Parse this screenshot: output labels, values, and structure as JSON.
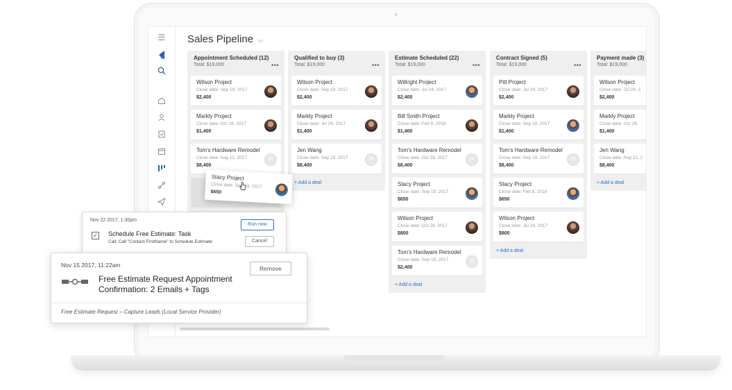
{
  "app": {
    "title": "Sales Pipeline"
  },
  "sidebar": {
    "icons": [
      "menu-icon",
      "logo-icon",
      "search-icon",
      "home-icon",
      "contacts-icon",
      "tasks-icon",
      "calendar-icon",
      "pipeline-icon",
      "automation-icon",
      "send-icon"
    ]
  },
  "columns": [
    {
      "name": "Appointment Scheduled (12)",
      "total": "Total: $19,000",
      "more": "•••",
      "cards": [
        {
          "name": "Wilson Project",
          "date": "Close date: Sep 19, 2017",
          "amount": "$2,400",
          "avatar": "photo"
        },
        {
          "name": "Markly Project",
          "date": "Close date: Oct 28, 2017",
          "amount": "$1,400",
          "avatar": "photo"
        },
        {
          "name": "Tom's Hardware Remodel",
          "date": "Close date: Aug 12, 2017",
          "amount": "$8,400",
          "avatar": "JR"
        }
      ]
    },
    {
      "name": "Qualified to buy (3)",
      "total": "Total: $19,000",
      "more": "•••",
      "cards": [
        {
          "name": "Wilson Project",
          "date": "Close date: Sep 19, 2017",
          "amount": "$2,400",
          "avatar": "photo"
        },
        {
          "name": "Markly Project",
          "date": "Close date: Jul 24, 2017",
          "amount": "$1,400",
          "avatar": "photo"
        },
        {
          "name": "Jen Wang",
          "date": "Close date: Sep 19, 2017",
          "amount": "$8,400",
          "avatar": "JR"
        }
      ],
      "add": "+ Add a deal"
    },
    {
      "name": "Estimate Scheduled (22)",
      "total": "Total: $19,000",
      "more": "•••",
      "cards": [
        {
          "name": "Willright Project",
          "date": "Close date: Jul 24, 2017",
          "amount": "$2,400",
          "avatar": "blue"
        },
        {
          "name": "Bill Smith Project",
          "date": "Close date: Feb 8, 2018",
          "amount": "$1,400",
          "avatar": "photo"
        },
        {
          "name": "Tom's Hardware Remodel",
          "date": "Close date: Oct 28, 2017",
          "amount": "$8,400",
          "avatar": "JR"
        },
        {
          "name": "Stacy Project",
          "date": "Close date: Sep 19, 2017",
          "amount": "$650",
          "avatar": "blue"
        },
        {
          "name": "Wilson Project",
          "date": "Close date: Oct 28, 2017",
          "amount": "$800",
          "avatar": "photo"
        },
        {
          "name": "Tom's Hardware Remodel",
          "date": "Close date: Sep 19, 2017",
          "amount": "$2,400",
          "avatar": "JR"
        }
      ],
      "add": "+ Add a deal"
    },
    {
      "name": "Contract Signed (5)",
      "total": "Total: $19,000",
      "more": "•••",
      "cards": [
        {
          "name": "Pitt Project",
          "date": "Close date: Jul 24, 2017",
          "amount": "$2,400",
          "avatar": "photo"
        },
        {
          "name": "Markly Project",
          "date": "Close date: Sep 19, 2017",
          "amount": "$1,400",
          "avatar": "blue"
        },
        {
          "name": "Tom's Hardware Remodel",
          "date": "Close date: Sep 19, 2017",
          "amount": "$8,400",
          "avatar": "JR"
        },
        {
          "name": "Stacy Project",
          "date": "Close date: Feb 8, 2018",
          "amount": "$650",
          "avatar": "blue"
        },
        {
          "name": "Wilson Project",
          "date": "Close date: Jul 24, 2017",
          "amount": "$800",
          "avatar": "photo"
        }
      ],
      "add": "+ Add a deal"
    },
    {
      "name": "Payment made (3)",
      "total": "Total: $19,000",
      "more": "",
      "cards": [
        {
          "name": "Wilson Project",
          "date": "Close date: Jul 24, 2",
          "amount": "$2,400",
          "avatar": "none"
        },
        {
          "name": "Markly Project",
          "date": "Close date: Oct 28,",
          "amount": "$1,400",
          "avatar": "none"
        },
        {
          "name": "Jen Wang",
          "date": "Close date: Aug 12, 2",
          "amount": "$8,400",
          "avatar": "none"
        }
      ],
      "add": "+ Add a deal"
    }
  ],
  "dragging_card": {
    "name": "Stacy Project",
    "date": "Close date: Sep 19, 2017",
    "amount": "$650"
  },
  "task_panel": {
    "timestamp": "Nov 22 2017, 1:30pm",
    "title": "Schedule Free Estimate: Task",
    "call": "Call: Call \"Contact.FirstName\" to Schedule Estimate",
    "run_label": "Run now",
    "cancel_label": "Cancel"
  },
  "automation_panel": {
    "timestamp": "Nov 15 2017, 11:22am",
    "title": "Free Estimate Request  Appointment Confirmation:  2 Emails + Tags",
    "remove_label": "Remove",
    "footer": "Free Estimate Request – Capture Leads (Local Service Provider)"
  }
}
